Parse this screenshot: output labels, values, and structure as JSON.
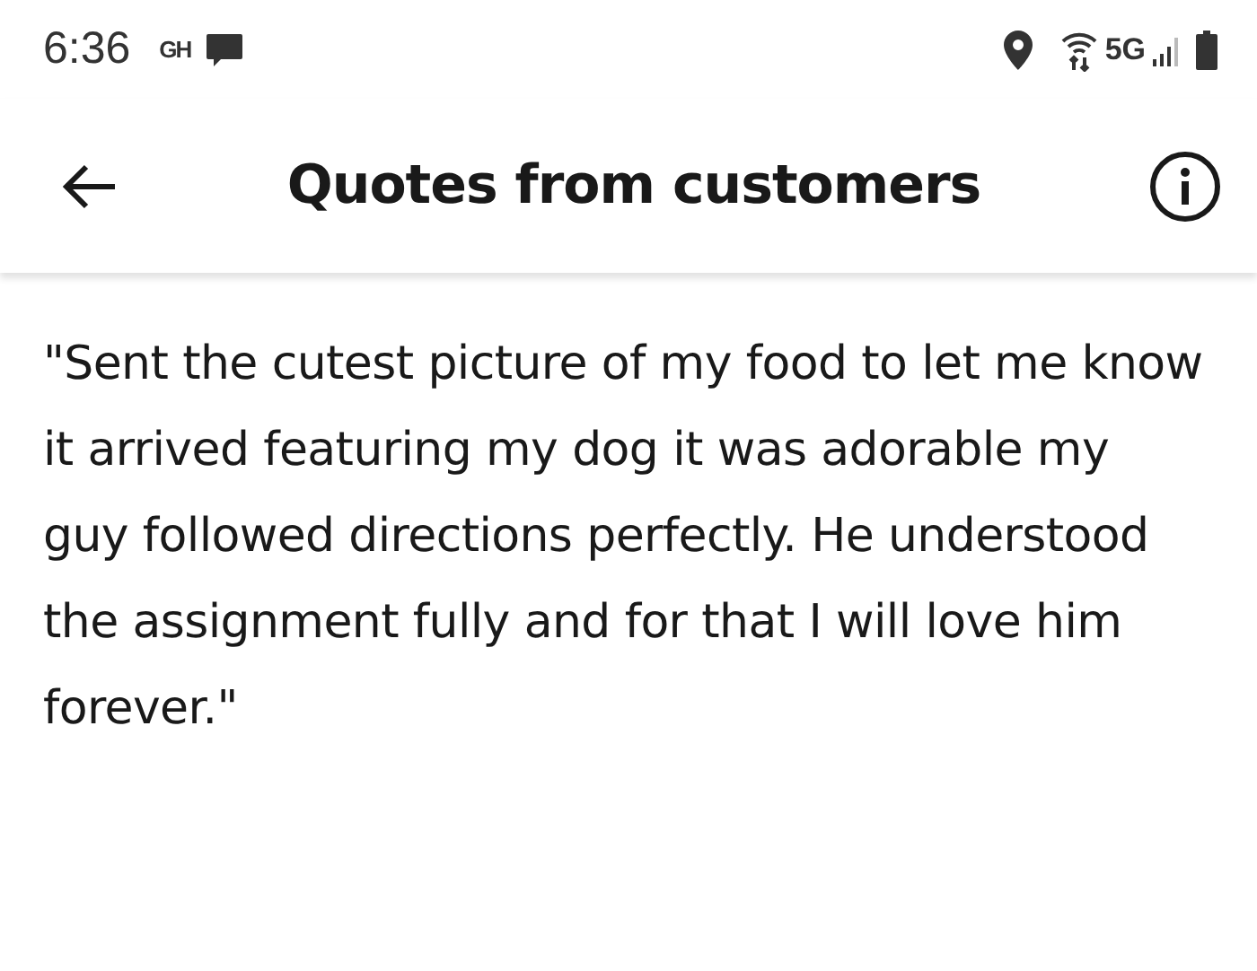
{
  "status_bar": {
    "time": "6:36",
    "notification_badge": "GH",
    "network": "5G"
  },
  "header": {
    "title": "Quotes from customers"
  },
  "quote": "\"Sent the cutest picture of my food to let me know it arrived featuring my dog it was adorable my guy followed directions perfectly. He understood the assignment fully and for that I will love him forever.\""
}
